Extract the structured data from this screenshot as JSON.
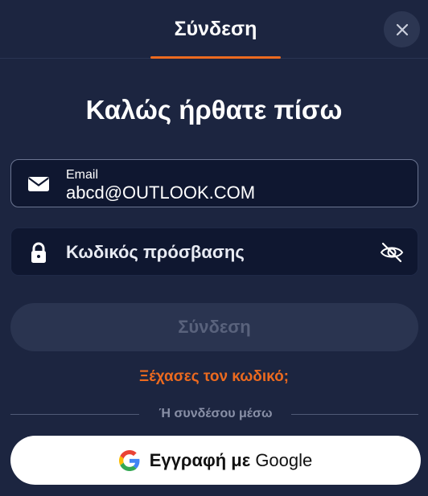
{
  "header": {
    "tab_title": "Σύνδεση",
    "close_icon": "close-icon"
  },
  "welcome_title": "Καλώς ήρθατε πίσω",
  "email_field": {
    "label": "Email",
    "value": "abcd@OUTLOOK.COM",
    "icon": "envelope-icon"
  },
  "password_field": {
    "placeholder": "Κωδικός πρόσβασης",
    "value": "",
    "icon": "lock-icon",
    "toggle_icon": "eye-off-icon"
  },
  "submit_button": {
    "label": "Σύνδεση",
    "state": "disabled"
  },
  "forgot_password": "Ξέχασες τον κωδικό;",
  "divider_text": "Ή συνδέσου μέσω",
  "google_button": {
    "label_prefix": "Εγγραφή με",
    "label_provider": "Google",
    "icon": "google-icon"
  },
  "colors": {
    "background": "#1c2540",
    "field_background": "#0f1730",
    "accent": "#ec6a1f",
    "button_disabled": "#2a3450",
    "google_button": "#ffffff"
  }
}
